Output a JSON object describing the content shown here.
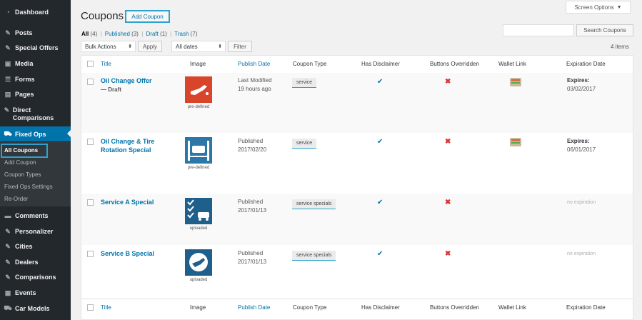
{
  "sidebar": {
    "items": [
      {
        "label": "Dashboard",
        "icon": "dashboard-icon"
      },
      {
        "label": "Posts",
        "icon": "pin-icon"
      },
      {
        "label": "Special Offers",
        "icon": "pin-icon"
      },
      {
        "label": "Media",
        "icon": "media-icon"
      },
      {
        "label": "Forms",
        "icon": "forms-icon"
      },
      {
        "label": "Pages",
        "icon": "pages-icon"
      },
      {
        "label": "Direct Comparisons",
        "icon": "pin-icon"
      },
      {
        "label": "Fixed Ops",
        "icon": "car-icon"
      },
      {
        "label": "Comments",
        "icon": "comment-icon"
      },
      {
        "label": "Personalizer",
        "icon": "pin-icon"
      },
      {
        "label": "Cities",
        "icon": "pin-icon"
      },
      {
        "label": "Dealers",
        "icon": "pin-icon"
      },
      {
        "label": "Comparisons",
        "icon": "pin-icon"
      },
      {
        "label": "Events",
        "icon": "calendar-icon"
      },
      {
        "label": "Car Models",
        "icon": "car-icon"
      }
    ],
    "submenu": [
      "All Coupons",
      "Add Coupon",
      "Coupon Types",
      "Fixed Ops Settings",
      "Re-Order"
    ]
  },
  "header": {
    "title": "Coupons",
    "add_button": "Add Coupon",
    "screen_options": "Screen Options"
  },
  "filters": {
    "all": "All",
    "all_count": "(4)",
    "published": "Published",
    "published_count": "(3)",
    "draft": "Draft",
    "draft_count": "(1)",
    "trash": "Trash",
    "trash_count": "(7)",
    "sep": "|",
    "bulk_actions": "Bulk Actions",
    "apply": "Apply",
    "all_dates": "All dates",
    "filter": "Filter",
    "search_button": "Search Coupons",
    "items_count": "4 items"
  },
  "table": {
    "columns": [
      "Title",
      "Image",
      "Publish Date",
      "Coupon Type",
      "Has Disclaimer",
      "Buttons Overridden",
      "Wallet Link",
      "Expiration Date"
    ],
    "rows": [
      {
        "title": "Oil Change Offer",
        "status": "— Draft",
        "image_caption": "pre-defined",
        "pub_line1": "Last Modified",
        "pub_line2": "19 hours ago",
        "coupon_type": "service",
        "disclaimer": "✔",
        "overridden": "✖",
        "exp_label": "Expires:",
        "exp_date": "03/02/2017"
      },
      {
        "title": "Oil Change & Tire Rotation Special",
        "status": "",
        "image_caption": "pre-defined",
        "pub_line1": "Published",
        "pub_line2": "2017/02/20",
        "coupon_type": "service",
        "disclaimer": "✔",
        "overridden": "✖",
        "exp_label": "Expires:",
        "exp_date": "06/01/2017"
      },
      {
        "title": "Service A Special",
        "status": "",
        "image_caption": "uploaded",
        "pub_line1": "Published",
        "pub_line2": "2017/01/13",
        "coupon_type": "service specials",
        "disclaimer": "✔",
        "overridden": "✖",
        "exp_none": "no expiration"
      },
      {
        "title": "Service B Special",
        "status": "",
        "image_caption": "uploaded",
        "pub_line1": "Published",
        "pub_line2": "2017/01/13",
        "coupon_type": "service specials",
        "disclaimer": "✔",
        "overridden": "✖",
        "exp_none": "no expiration"
      }
    ]
  },
  "colors": {
    "accent": "#0073aa",
    "sidebar": "#23282d",
    "highlight": "#2ea2cc"
  }
}
